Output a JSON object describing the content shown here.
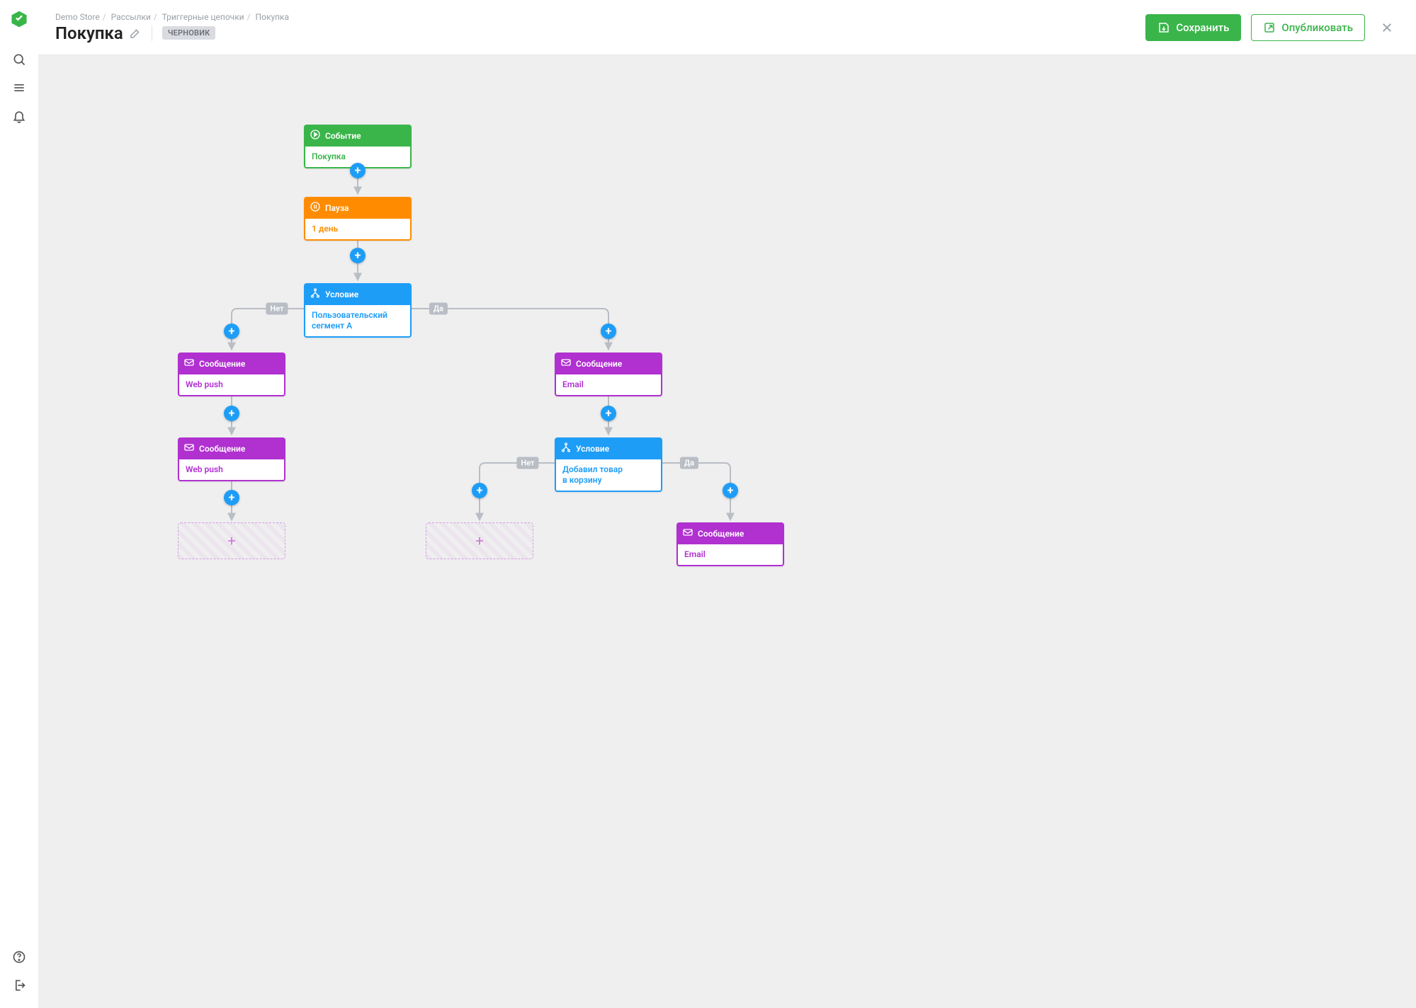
{
  "breadcrumb": [
    "Demo Store",
    "Рассылки",
    "Триггерные цепочки",
    "Покупка"
  ],
  "page": {
    "title": "Покупка",
    "status_badge": "ЧЕРНОВИК"
  },
  "actions": {
    "save": "Сохранить",
    "publish": "Опубликовать"
  },
  "labels": {
    "yes": "Да",
    "no": "Нет"
  },
  "colors": {
    "event": "#3ab54a",
    "pause": "#ff8c00",
    "condition": "#1e9df7",
    "message": "#b030d0",
    "canvas_bg": "#efefef",
    "edge": "#b9bdc4"
  },
  "nodes": {
    "n1": {
      "kind": "event",
      "head": "Событие",
      "body": "Покупка"
    },
    "n2": {
      "kind": "pause",
      "head": "Пауза",
      "body": "1 день"
    },
    "n3": {
      "kind": "condition",
      "head": "Условие",
      "body": "Пользовательский сегмент A"
    },
    "n4": {
      "kind": "message",
      "head": "Сообщение",
      "body": "Web push"
    },
    "n5": {
      "kind": "message",
      "head": "Сообщение",
      "body": "Web push"
    },
    "n6": {
      "kind": "message",
      "head": "Сообщение",
      "body": "Email"
    },
    "n7": {
      "kind": "condition",
      "head": "Условие",
      "body": "Добавил товар в корзину"
    },
    "n8": {
      "kind": "message",
      "head": "Сообщение",
      "body": "Email"
    }
  },
  "edges": [
    {
      "from": "n1",
      "to": "n2"
    },
    {
      "from": "n2",
      "to": "n3"
    },
    {
      "from": "n3",
      "to": "n4",
      "label": "no"
    },
    {
      "from": "n3",
      "to": "n6",
      "label": "yes"
    },
    {
      "from": "n4",
      "to": "n5"
    },
    {
      "from": "n5",
      "to": "slot_left"
    },
    {
      "from": "n6",
      "to": "n7"
    },
    {
      "from": "n7",
      "to": "slot_mid",
      "label": "no"
    },
    {
      "from": "n7",
      "to": "n8",
      "label": "yes"
    }
  ]
}
